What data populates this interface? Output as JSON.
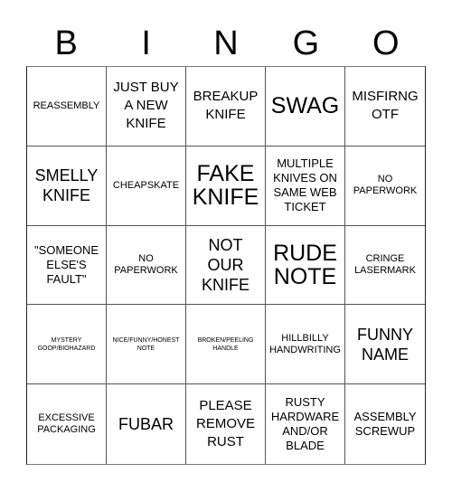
{
  "header": {
    "letters": [
      "B",
      "I",
      "N",
      "G",
      "O"
    ]
  },
  "cells": [
    {
      "text": "REASSEMBLY",
      "size": "sm"
    },
    {
      "text": "JUST BUY A NEW KNIFE",
      "size": "lg"
    },
    {
      "text": "BREAKUP KNIFE",
      "size": "lg"
    },
    {
      "text": "SWAG",
      "size": "xxl"
    },
    {
      "text": "MISFIRNG OTF",
      "size": "lg"
    },
    {
      "text": "SMELLY KNIFE",
      "size": "xl"
    },
    {
      "text": "CHEAPSKATE",
      "size": "sm"
    },
    {
      "text": "FAKE KNIFE",
      "size": "xxl"
    },
    {
      "text": "MULTIPLE KNIVES ON SAME WEB TICKET",
      "size": "md"
    },
    {
      "text": "NO PAPERWORK",
      "size": "sm"
    },
    {
      "text": "\"SOMEONE ELSE'S FAULT\"",
      "size": "md"
    },
    {
      "text": "NO PAPERWORK",
      "size": "sm"
    },
    {
      "text": "NOT OUR KNIFE",
      "size": "xl"
    },
    {
      "text": "RUDE NOTE",
      "size": "xxl"
    },
    {
      "text": "CRINGE LASERMARK",
      "size": "sm"
    },
    {
      "text": "MYSTERY GOOP/BIOHAZARD",
      "size": "xs"
    },
    {
      "text": "NICE/FUNNY/HONEST NOTE",
      "size": "xs"
    },
    {
      "text": "BROKEN/PEELING HANDLE",
      "size": "xs"
    },
    {
      "text": "HILLBILLY HANDWRITING",
      "size": "sm"
    },
    {
      "text": "FUNNY NAME",
      "size": "xl"
    },
    {
      "text": "EXCESSIVE PACKAGING",
      "size": "sm"
    },
    {
      "text": "FUBAR",
      "size": "xl"
    },
    {
      "text": "PLEASE REMOVE RUST",
      "size": "lg"
    },
    {
      "text": "RUSTY HARDWARE AND/OR BLADE",
      "size": "md"
    },
    {
      "text": "ASSEMBLY SCREWUP",
      "size": "md"
    }
  ]
}
